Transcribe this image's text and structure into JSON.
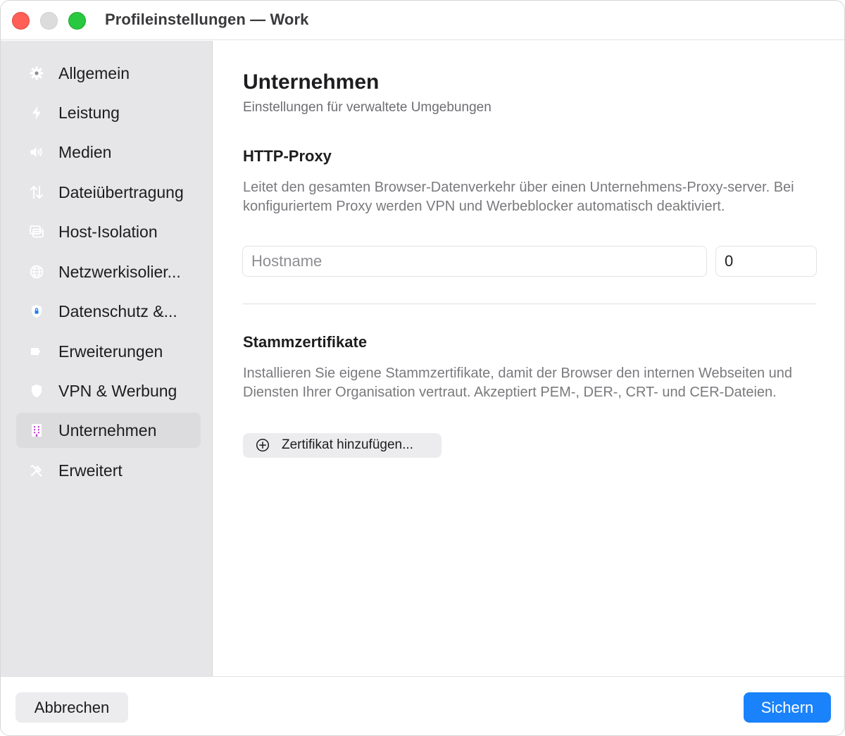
{
  "window": {
    "title": "Profileinstellungen — Work"
  },
  "sidebar": {
    "items": [
      {
        "label": "Allgemein",
        "icon": "gear-icon",
        "color": "#8e8e93"
      },
      {
        "label": "Leistung",
        "icon": "bolt-icon",
        "color": "#f7822a"
      },
      {
        "label": "Medien",
        "icon": "speaker-icon",
        "color": "#f23e5c"
      },
      {
        "label": "Dateiübertragung",
        "icon": "transfer-arrows-icon",
        "color": "#3ab8e6"
      },
      {
        "label": "Host-Isolation",
        "icon": "window-stack-icon",
        "color": "#2cc2c8"
      },
      {
        "label": "Netzwerkisolier...",
        "icon": "globe-icon",
        "color": "#6a5ae8"
      },
      {
        "label": "Datenschutz &...",
        "icon": "lock-shield-icon",
        "color": "#1a7cf0"
      },
      {
        "label": "Erweiterungen",
        "icon": "puzzle-icon",
        "color": "#23c4a3"
      },
      {
        "label": "VPN & Werbung",
        "icon": "shield-icon",
        "color": "#2fc25b"
      },
      {
        "label": "Unternehmen",
        "icon": "building-icon",
        "color": "#c44ad8"
      },
      {
        "label": "Erweitert",
        "icon": "tools-icon",
        "color": "#8e8e93"
      }
    ],
    "active_index": 9
  },
  "main": {
    "title": "Unternehmen",
    "subtitle": "Einstellungen für verwaltete Umgebungen",
    "proxy": {
      "heading": "HTTP-Proxy",
      "description": "Leitet den gesamten Browser-Datenverkehr über einen Unternehmens-Proxy-server. Bei konfiguriertem Proxy werden VPN und Werbeblocker automatisch deaktiviert.",
      "host_placeholder": "Hostname",
      "host_value": "",
      "port_value": "0"
    },
    "certs": {
      "heading": "Stammzertifikate",
      "description": "Installieren Sie eigene Stammzertifikate, damit der Browser den internen Webseiten und Diensten Ihrer Organisation vertraut. Akzeptiert PEM-, DER-, CRT- und CER-Dateien.",
      "add_button_label": "Zertifikat hinzufügen..."
    }
  },
  "footer": {
    "cancel_label": "Abbrechen",
    "save_label": "Sichern",
    "accent": "#1a82fb"
  }
}
